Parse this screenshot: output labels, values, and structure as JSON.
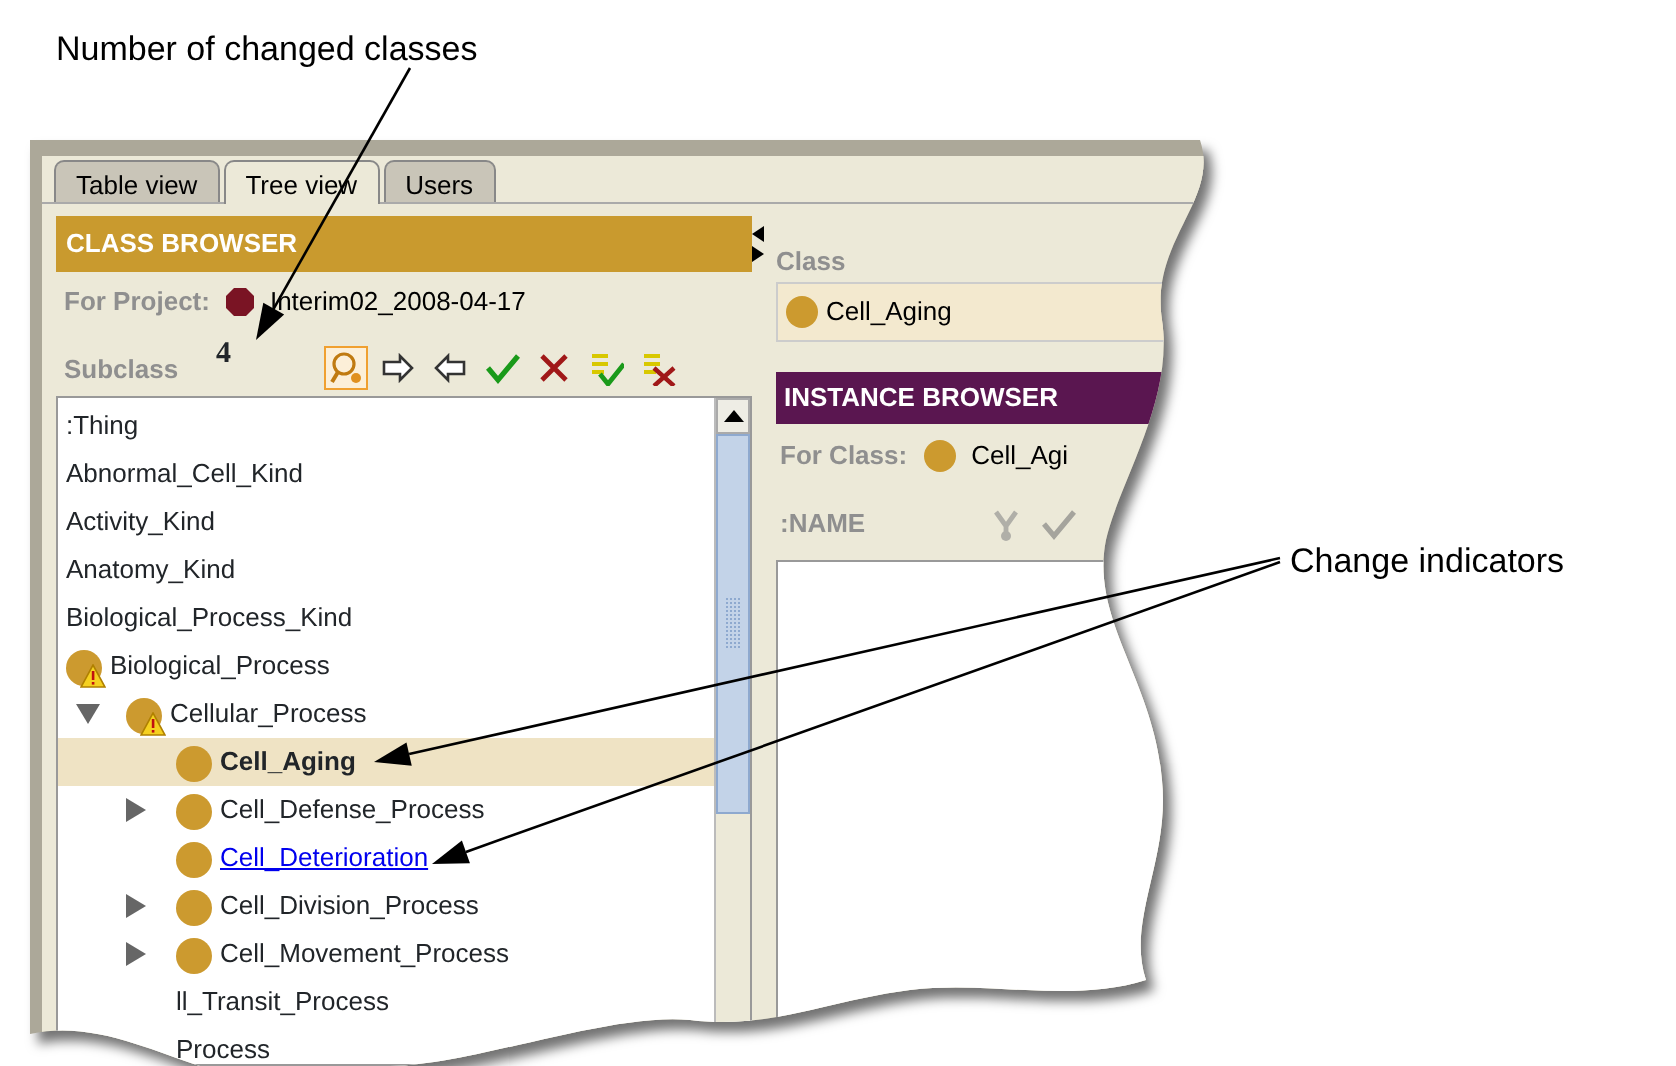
{
  "annotations": [
    {
      "kind": "top",
      "text": "Number of changed classes"
    },
    {
      "kind": "right",
      "text": "Change indicators"
    }
  ],
  "tabs": [
    {
      "label": "Table view",
      "selected": false
    },
    {
      "label": "Tree view",
      "selected": true
    },
    {
      "label": "Users",
      "selected": false
    }
  ],
  "class_browser": {
    "title": "CLASS BROWSER",
    "project_label": "For Project:",
    "project": "Interim02_2008-04-17",
    "subclass_label": "Subclass",
    "changed_count": "4",
    "tools": [
      {
        "kind": "search",
        "selected": true
      },
      {
        "kind": "right",
        "selected": false
      },
      {
        "kind": "left",
        "selected": false
      },
      {
        "kind": "check",
        "selected": false
      },
      {
        "kind": "cross",
        "selected": false
      },
      {
        "kind": "check-all",
        "selected": false
      },
      {
        "kind": "cross-all",
        "selected": false
      }
    ],
    "tree": [
      {
        "label": ":Thing",
        "kind": "plain",
        "selected": false
      },
      {
        "label": "Abnormal_Cell_Kind",
        "kind": "plain",
        "selected": false
      },
      {
        "label": "Activity_Kind",
        "kind": "plain",
        "selected": false
      },
      {
        "label": "Anatomy_Kind",
        "kind": "plain",
        "selected": false
      },
      {
        "label": "Biological_Process_Kind",
        "kind": "plain",
        "selected": false
      },
      {
        "label": "Biological_Process",
        "kind": "class",
        "warning": true,
        "selected": false,
        "children": [
          {
            "label": "Cellular_Process",
            "kind": "class",
            "warning": true,
            "selected": false,
            "expanded": true,
            "children": [
              {
                "label": "Cell_Aging",
                "kind": "bold",
                "warning": false,
                "selected": true
              },
              {
                "label": "Cell_Defense_Process",
                "kind": "class",
                "warning": false,
                "selected": false,
                "expanded": false
              },
              {
                "label": "Cell_Deterioration",
                "kind": "link",
                "warning": false,
                "selected": false
              },
              {
                "label": "Cell_Division_Process",
                "kind": "class",
                "warning": false,
                "selected": false,
                "expanded": false
              },
              {
                "label": "Cell_Movement_Process",
                "kind": "class",
                "warning": false,
                "selected": false,
                "expanded": false
              },
              {
                "label": "ll_Transit_Process",
                "kind": "plain",
                "selected": false
              },
              {
                "label": "Process",
                "kind": "plain",
                "selected": false
              }
            ]
          }
        ]
      }
    ]
  },
  "class_panel": {
    "label": "Class",
    "value": "Cell_Aging"
  },
  "instance_browser": {
    "title": "INSTANCE BROWSER",
    "for_label": "For Class:",
    "for_value": "Cell_Agi",
    "column": ":NAME",
    "tools": [
      {
        "kind": "branch",
        "disabled": true
      },
      {
        "kind": "check",
        "disabled": true
      }
    ]
  }
}
